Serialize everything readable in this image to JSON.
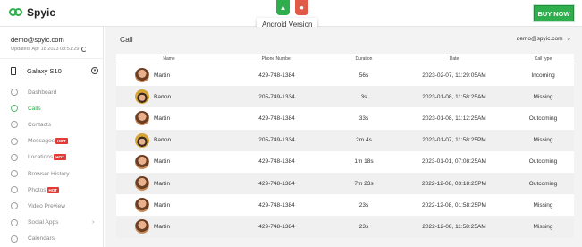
{
  "app": {
    "logo_text": "Spyic",
    "buy_label": "BUY NOW",
    "tooltip": "Android Version"
  },
  "sidebar": {
    "account": "demo@spyic.com",
    "updated": "Updated: Apr 18 2023 08:51:29",
    "device": "Galaxy S10",
    "hot_label": "HOT",
    "items": [
      {
        "label": "Dashboard",
        "icon": "dashboard-icon",
        "active": false,
        "hot": false
      },
      {
        "label": "Calls",
        "icon": "phone-icon",
        "active": true,
        "hot": false
      },
      {
        "label": "Contacts",
        "icon": "contacts-icon",
        "active": false,
        "hot": false
      },
      {
        "label": "Messages",
        "icon": "message-icon",
        "active": false,
        "hot": true
      },
      {
        "label": "Locations",
        "icon": "location-icon",
        "active": false,
        "hot": true
      },
      {
        "label": "Browser History",
        "icon": "globe-icon",
        "active": false,
        "hot": false
      },
      {
        "label": "Photos",
        "icon": "photo-icon",
        "active": false,
        "hot": true
      },
      {
        "label": "Video Preview",
        "icon": "video-icon",
        "active": false,
        "hot": false
      },
      {
        "label": "Social Apps",
        "icon": "chat-icon",
        "active": false,
        "hot": false,
        "chevron": true
      },
      {
        "label": "Calendars",
        "icon": "calendar-icon",
        "active": false,
        "hot": false
      }
    ]
  },
  "main": {
    "title": "Call",
    "account_dropdown": "demo@spyic.com",
    "columns": [
      "Name",
      "Phone Number",
      "Duration",
      "Date",
      "Call type"
    ],
    "rows": [
      {
        "name": "Martin",
        "phone": "429-748-1384",
        "duration": "56s",
        "date": "2023-02-07, 11:29:05AM",
        "type": "Incoming",
        "avatar": "martin"
      },
      {
        "name": "Barton",
        "phone": "205-749-1334",
        "duration": "3s",
        "date": "2023-01-08, 11:58:25AM",
        "type": "Missing",
        "avatar": "barton"
      },
      {
        "name": "Martin",
        "phone": "429-748-1384",
        "duration": "33s",
        "date": "2023-01-08, 11:12:25AM",
        "type": "Outcoming",
        "avatar": "martin"
      },
      {
        "name": "Barton",
        "phone": "205-749-1334",
        "duration": "2m 4s",
        "date": "2023-01-07, 11:58:25PM",
        "type": "Missing",
        "avatar": "barton"
      },
      {
        "name": "Martin",
        "phone": "429-748-1384",
        "duration": "1m 18s",
        "date": "2023-01-01, 07:08:25AM",
        "type": "Outcoming",
        "avatar": "martin"
      },
      {
        "name": "Martin",
        "phone": "429-748-1384",
        "duration": "7m 23s",
        "date": "2022-12-08, 03:18:25PM",
        "type": "Outcoming",
        "avatar": "martin"
      },
      {
        "name": "Martin",
        "phone": "429-748-1384",
        "duration": "23s",
        "date": "2022-12-08, 01:58:25PM",
        "type": "Missing",
        "avatar": "martin"
      },
      {
        "name": "Martin",
        "phone": "429-748-1384",
        "duration": "23s",
        "date": "2022-12-08, 11:58:25AM",
        "type": "Missing",
        "avatar": "martin"
      }
    ]
  },
  "colors": {
    "accent": "#2fae4e",
    "hot": "#e53935",
    "ios": "#e05a47"
  }
}
